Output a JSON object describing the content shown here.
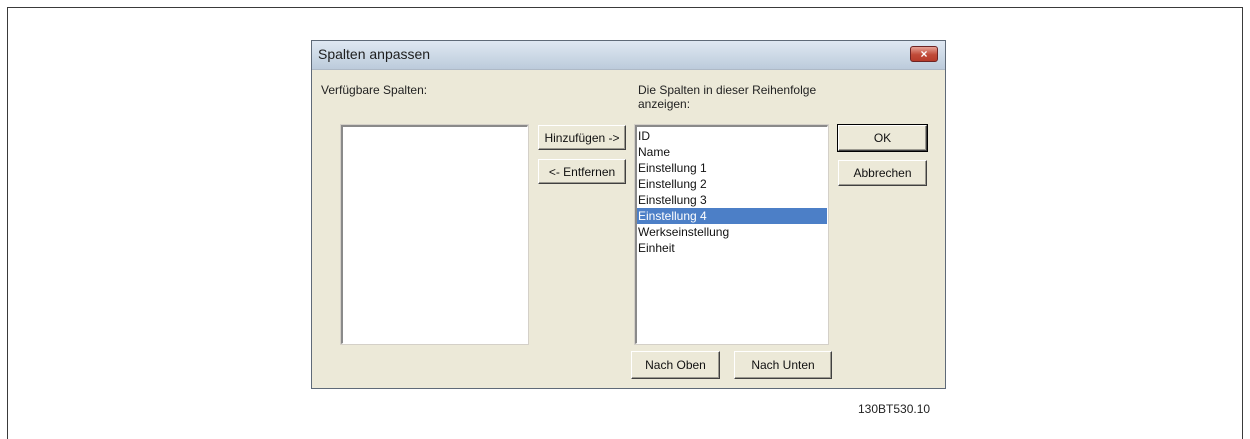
{
  "dialog": {
    "title": "Spalten anpassen",
    "close_label": "×",
    "available_label": "Verfügbare Spalten:",
    "order_label_line1": "Die Spalten in dieser Reihenfolge",
    "order_label_line2": "anzeigen:",
    "available_items": [],
    "ordered_items": [
      {
        "label": "ID",
        "selected": false
      },
      {
        "label": "Name",
        "selected": false
      },
      {
        "label": "Einstellung 1",
        "selected": false
      },
      {
        "label": "Einstellung 2",
        "selected": false
      },
      {
        "label": "Einstellung 3",
        "selected": false
      },
      {
        "label": "Einstellung 4",
        "selected": true
      },
      {
        "label": "Werkseinstellung",
        "selected": false
      },
      {
        "label": "Einheit",
        "selected": false
      }
    ],
    "buttons": {
      "add": "Hinzufügen ->",
      "remove": "<- Entfernen",
      "ok": "OK",
      "cancel": "Abbrechen",
      "move_up": "Nach Oben",
      "move_down": "Nach Unten"
    }
  },
  "figure_code": "130BT530.10",
  "colors": {
    "selection": "#4c7fc7",
    "dialog_face": "#ece9d8",
    "close_button": "#c04a38"
  }
}
